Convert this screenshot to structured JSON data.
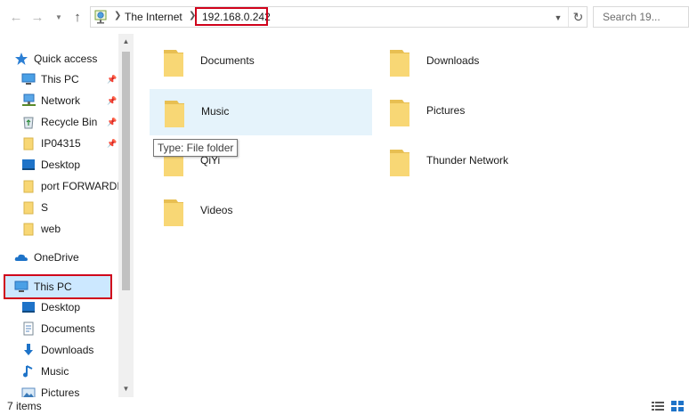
{
  "address_bar": {
    "back_icon": "arrow-left-icon",
    "forward_icon": "arrow-right-icon",
    "recent_icon": "chevron-down-icon",
    "up_icon": "arrow-up-icon",
    "location_icon": "network-location-icon",
    "crumbs": [
      "The Internet",
      "192.168.0.242"
    ],
    "highlight_color": "#d0021b",
    "refresh_icon": "refresh-icon"
  },
  "search": {
    "placeholder": "Search 19..."
  },
  "nav": {
    "items": [
      {
        "label": "Quick access",
        "icon": "star-icon",
        "pinned": false
      },
      {
        "label": "This PC",
        "icon": "computer-icon",
        "pinned": true
      },
      {
        "label": "Network",
        "icon": "network-icon",
        "pinned": true
      },
      {
        "label": "Recycle Bin",
        "icon": "recycle-bin-icon",
        "pinned": true
      },
      {
        "label": "IP04315",
        "icon": "folder-icon",
        "pinned": true
      },
      {
        "label": "Desktop",
        "icon": "desktop-icon",
        "pinned": false
      },
      {
        "label": "port FORWARDII",
        "icon": "folder-icon",
        "pinned": false
      },
      {
        "label": "S",
        "icon": "folder-icon",
        "pinned": false
      },
      {
        "label": "web",
        "icon": "folder-icon",
        "pinned": false
      },
      {
        "label": "OneDrive",
        "icon": "cloud-icon",
        "pinned": false
      },
      {
        "label": "This PC",
        "icon": "computer-icon",
        "pinned": false,
        "selected": true
      },
      {
        "label": "Desktop",
        "icon": "desktop-icon",
        "pinned": false
      },
      {
        "label": "Documents",
        "icon": "documents-icon",
        "pinned": false
      },
      {
        "label": "Downloads",
        "icon": "download-icon",
        "pinned": false
      },
      {
        "label": "Music",
        "icon": "music-icon",
        "pinned": false
      },
      {
        "label": "Pictures",
        "icon": "pictures-icon",
        "pinned": false
      }
    ]
  },
  "content": {
    "items": [
      {
        "name": "Documents",
        "icon": "folder-icon"
      },
      {
        "name": "Downloads",
        "icon": "folder-icon"
      },
      {
        "name": "Music",
        "icon": "folder-icon",
        "hovered": true
      },
      {
        "name": "Pictures",
        "icon": "folder-icon"
      },
      {
        "name": "QiYi",
        "icon": "folder-icon"
      },
      {
        "name": "Thunder Network",
        "icon": "folder-icon"
      },
      {
        "name": "Videos",
        "icon": "folder-icon"
      }
    ],
    "tooltip": "Type: File folder"
  },
  "status": {
    "count": "7 items"
  },
  "colors": {
    "selection": "#cce8ff",
    "hover": "#e5f3fb",
    "folder": "#f8d775",
    "accent_blue": "#1e73c8"
  }
}
